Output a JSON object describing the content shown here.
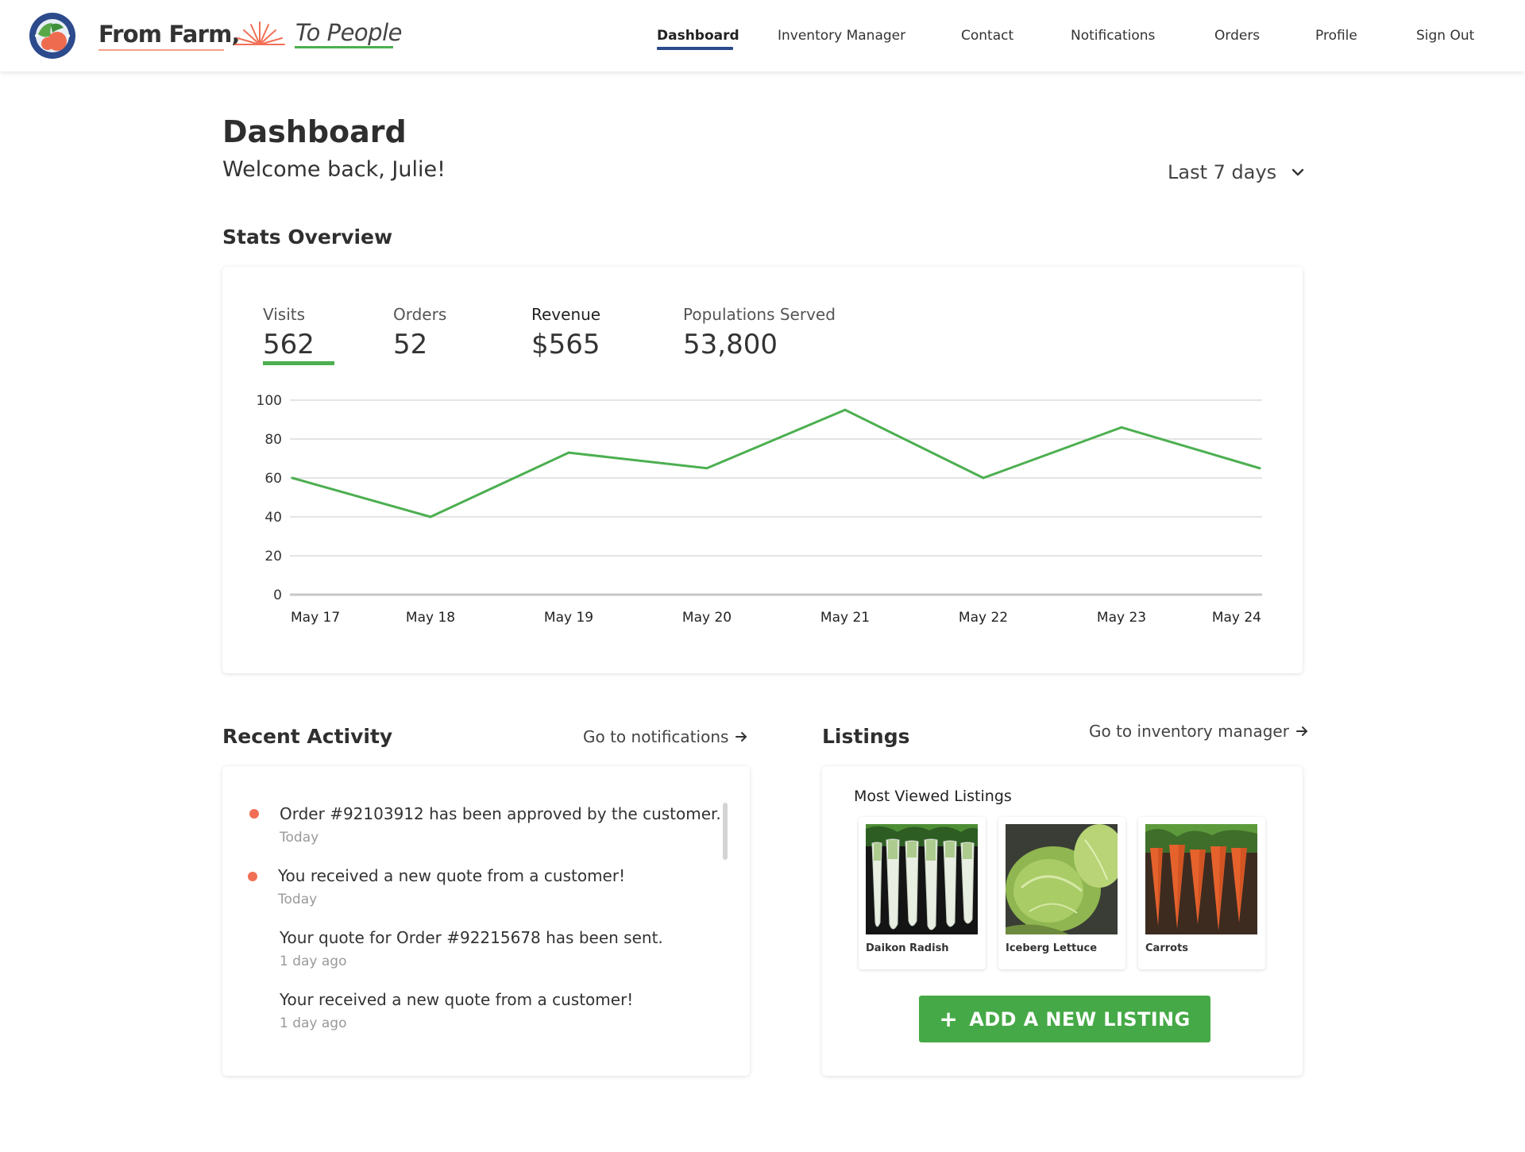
{
  "brand": {
    "name_part1": "From Farm,",
    "name_part2": "To People",
    "logo_icon": "farm-globe-logo-icon"
  },
  "nav": {
    "items": [
      {
        "label": "Dashboard",
        "active": true
      },
      {
        "label": "Inventory Manager",
        "active": false
      },
      {
        "label": "Contact",
        "active": false
      },
      {
        "label": "Notifications",
        "active": false
      },
      {
        "label": "Orders",
        "active": false
      },
      {
        "label": "Profile",
        "active": false
      },
      {
        "label": "Sign Out",
        "active": false
      }
    ],
    "active_color": "#2c4a8c"
  },
  "page": {
    "title": "Dashboard",
    "welcome": "Welcome back, Julie!",
    "range_selected": "Last 7 days"
  },
  "stats": {
    "section_title": "Stats Overview",
    "items": [
      {
        "label": "Visits",
        "value": "562",
        "selected": true
      },
      {
        "label": "Orders",
        "value": "52",
        "selected": false
      },
      {
        "label": "Revenue",
        "value": "$565",
        "selected": false
      },
      {
        "label": "Populations Served",
        "value": "53,800",
        "selected": false
      }
    ],
    "accent_color": "#4caf50"
  },
  "chart_data": {
    "type": "line",
    "categories": [
      "May 17",
      "May 18",
      "May 19",
      "May 20",
      "May 21",
      "May 22",
      "May 23",
      "May 24"
    ],
    "series": [
      {
        "values": [
          60,
          40,
          73,
          65,
          95,
          60,
          86,
          65
        ]
      }
    ],
    "ylim": [
      0,
      100
    ],
    "yticks": [
      "0",
      "20",
      "40",
      "60",
      "80",
      "100"
    ],
    "grid": true,
    "line_color": "#4caf50"
  },
  "activity": {
    "section_title": "Recent Activity",
    "link_label": "Go to notifications",
    "items": [
      {
        "text": "Order #92103912 has been approved by the customer.",
        "time": "Today",
        "unread": true
      },
      {
        "text": "You received a new quote from a customer!",
        "time": "Today",
        "unread": true
      },
      {
        "text": "Your quote for Order #92215678 has been sent.",
        "time": "1 day ago",
        "unread": false
      },
      {
        "text": "Your received a new quote from a customer!",
        "time": "1 day ago",
        "unread": false
      }
    ],
    "unread_color": "#f26f56"
  },
  "listings": {
    "section_title": "Listings",
    "link_label": "Go to inventory manager",
    "subtitle": "Most Viewed Listings",
    "items": [
      {
        "name": "Daikon Radish",
        "icon": "daikon-radish-photo"
      },
      {
        "name": "Iceberg Lettuce",
        "icon": "iceberg-lettuce-photo"
      },
      {
        "name": "Carrots",
        "icon": "carrots-photo"
      }
    ],
    "add_button_label": "ADD A NEW LISTING",
    "button_color": "#46a947"
  }
}
